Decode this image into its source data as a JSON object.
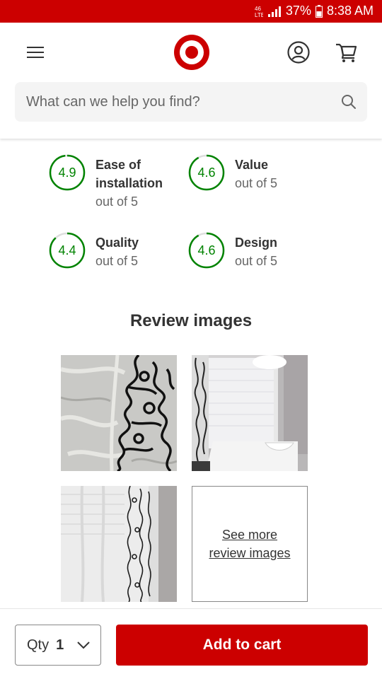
{
  "status_bar": {
    "battery": "37%",
    "time": "8:38 AM",
    "icons": [
      "nfc-icon",
      "signal-icon",
      "battery-icon"
    ]
  },
  "header": {
    "icons": [
      "menu-icon",
      "target-logo",
      "account-icon",
      "cart-icon"
    ]
  },
  "search": {
    "placeholder": "What can we help you find?",
    "icon": "search-icon"
  },
  "ratings": [
    {
      "value": "4.9",
      "score": 4.9,
      "label": "Ease of installation",
      "sub": "out of 5"
    },
    {
      "value": "4.6",
      "score": 4.6,
      "label": "Value",
      "sub": "out of 5"
    },
    {
      "value": "4.4",
      "score": 4.4,
      "label": "Quality",
      "sub": "out of 5"
    },
    {
      "value": "4.6",
      "score": 4.6,
      "label": "Design",
      "sub": "out of 5"
    }
  ],
  "review_images": {
    "title": "Review images",
    "see_more": "See more review images"
  },
  "footer": {
    "qty_label": "Qty",
    "qty_value": "1",
    "add_to_cart": "Add to cart"
  },
  "colors": {
    "brand": "#cc0000",
    "rating_green": "#008300"
  }
}
